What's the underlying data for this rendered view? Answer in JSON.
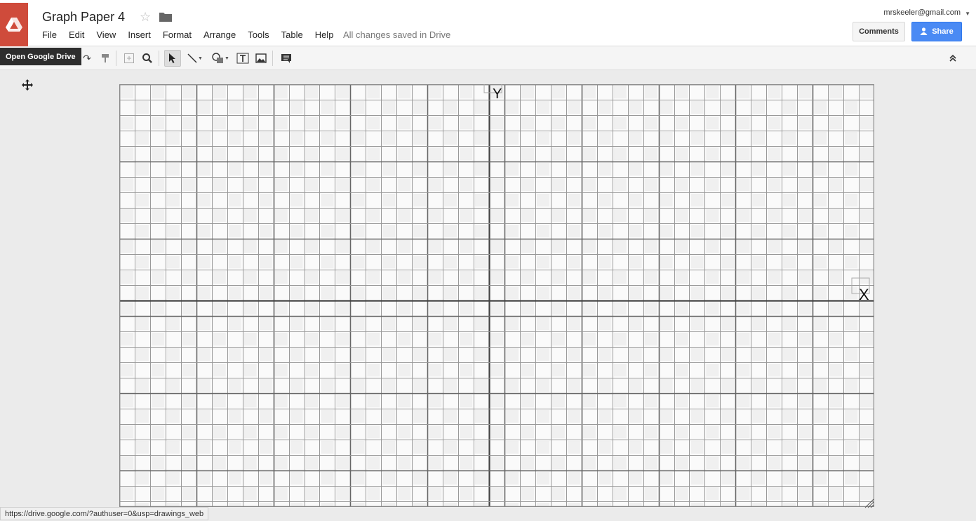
{
  "app": {
    "doc_title": "Graph Paper 4",
    "save_status": "All changes saved in Drive",
    "drive_tooltip": "Open Google Drive"
  },
  "menu": [
    "File",
    "Edit",
    "View",
    "Insert",
    "Format",
    "Arrange",
    "Tools",
    "Table",
    "Help"
  ],
  "account": {
    "email": "mrskeeler@gmail.com"
  },
  "buttons": {
    "comments": "Comments",
    "share": "Share"
  },
  "colors": {
    "drive_red": "#cf4b3b",
    "share_blue": "#4a8af4"
  },
  "toolbar_icons": [
    "redo-icon",
    "paint-format-icon",
    "zoom-fit-icon",
    "zoom-icon",
    "select-icon",
    "line-icon",
    "shape-icon",
    "textbox-icon",
    "image-icon",
    "comment-icon",
    "collapse-icon"
  ],
  "canvas": {
    "y_axis_label": "Y",
    "x_axis_label": "X",
    "grid_columns": 49,
    "grid_rows": 28
  },
  "status_url": "https://drive.google.com/?authuser=0&usp=drawings_web"
}
